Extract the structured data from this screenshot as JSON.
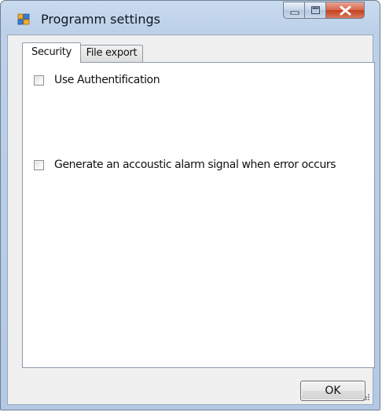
{
  "window": {
    "title": "Programm settings",
    "icon": "application-icon",
    "controls": [
      "minimize-icon",
      "maximize-icon",
      "close-icon"
    ]
  },
  "tabs": [
    {
      "label": "Security",
      "active": true
    },
    {
      "label": "File export",
      "active": false
    }
  ],
  "security": {
    "use_authentication": {
      "label": "Use Authentification",
      "checked": false
    },
    "acoustic_alarm": {
      "label": "Generate an accoustic alarm signal when error occurs",
      "checked": false
    }
  },
  "footer": {
    "ok_label": "OK"
  },
  "colors": {
    "close_button": "#c4401f",
    "frame": "#bcd0e8",
    "panel": "#ffffff"
  }
}
